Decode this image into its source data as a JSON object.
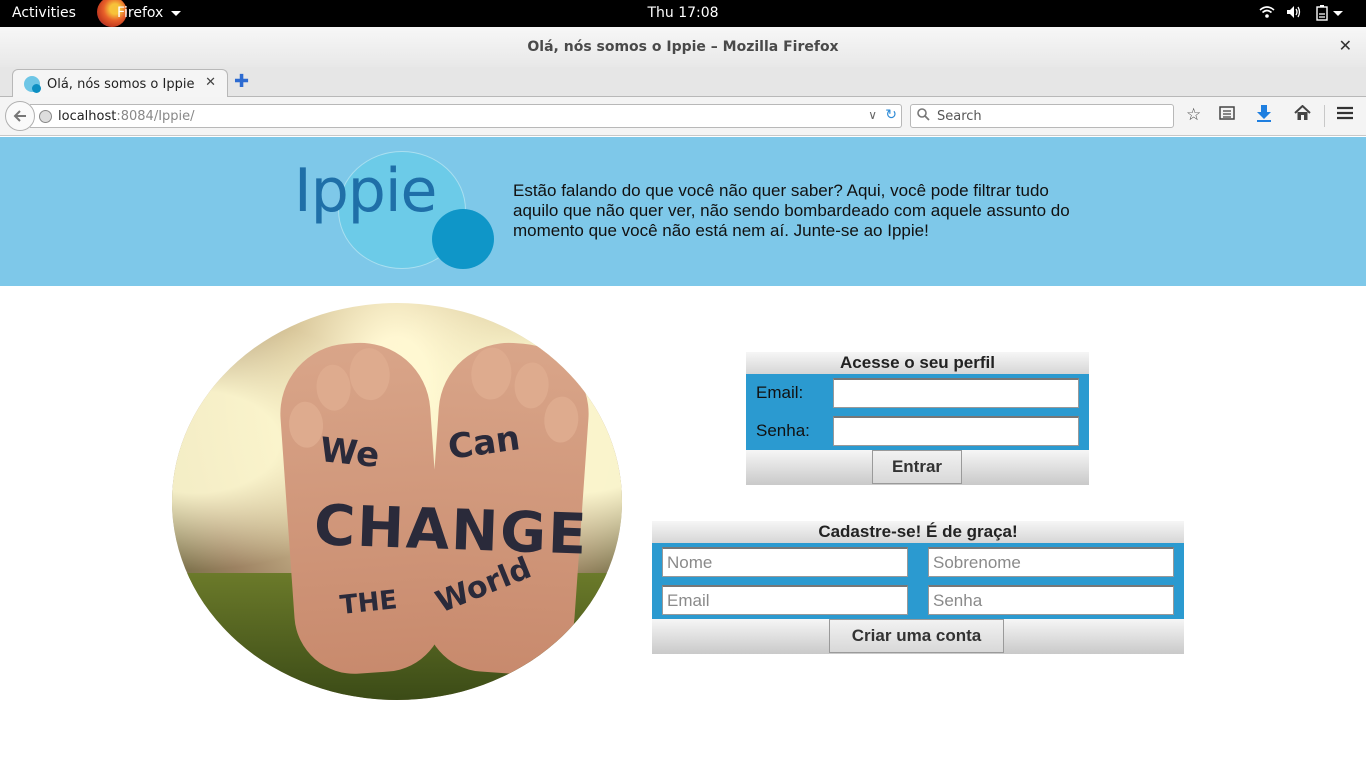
{
  "system_bar": {
    "activities": "Activities",
    "app_name": "Firefox",
    "clock": "Thu 17:08",
    "icons": [
      "wifi-icon",
      "volume-icon",
      "battery-icon",
      "power-caret-icon"
    ]
  },
  "window": {
    "title": "Olá, nós somos o Ippie – Mozilla Firefox"
  },
  "tabs": [
    {
      "label": "Olá, nós somos o Ippie",
      "icon": "ippie-favicon"
    }
  ],
  "navbar": {
    "url_host": "localhost",
    "url_rest": ":8084/Ippie/",
    "search_placeholder": "Search"
  },
  "page": {
    "logo_text": "Ippie",
    "tagline": "Estão falando do que você não quer saber? Aqui, você pode filtrar tudo aquilo que não quer ver, não sendo bombardeado com aquele assunto do momento que você não está nem aí. Junte-se ao Ippie!",
    "photo_text": {
      "we": "We",
      "can": "Can",
      "change": "CHANGE",
      "the": "THE",
      "world": "World"
    },
    "login": {
      "title": "Acesse o seu perfil",
      "email_label": "Email:",
      "password_label": "Senha:",
      "submit": "Entrar"
    },
    "signup": {
      "title": "Cadastre-se! É de graça!",
      "first_name_placeholder": "Nome",
      "last_name_placeholder": "Sobrenome",
      "email_placeholder": "Email",
      "password_placeholder": "Senha",
      "submit": "Criar uma conta"
    }
  },
  "colors": {
    "header_bg": "#7ec8e9",
    "form_body": "#2b9ad0",
    "logo_dark": "#0f96c8",
    "logo_light": "#6ccbe8"
  }
}
